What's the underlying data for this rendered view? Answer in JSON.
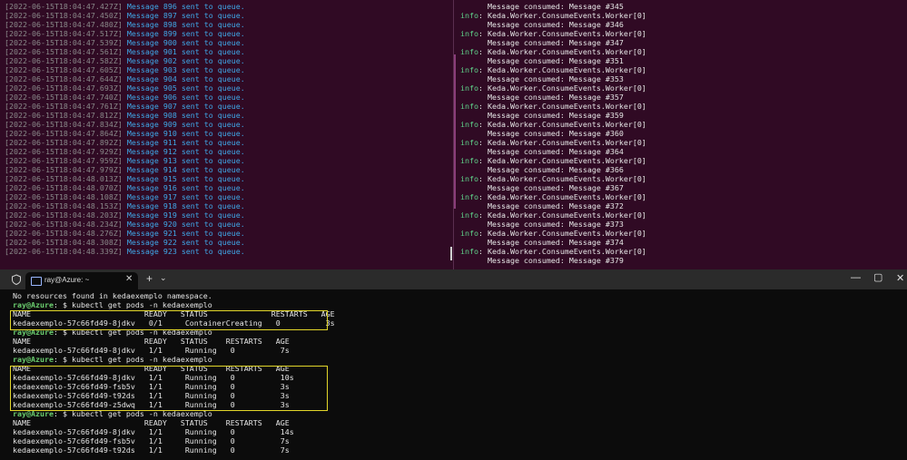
{
  "left_pane": {
    "lines": [
      {
        "ts": "[2022-06-15T18:04:47.427Z]",
        "msg": "Message 896 sent to queue."
      },
      {
        "ts": "[2022-06-15T18:04:47.450Z]",
        "msg": "Message 897 sent to queue."
      },
      {
        "ts": "[2022-06-15T18:04:47.480Z]",
        "msg": "Message 898 sent to queue."
      },
      {
        "ts": "[2022-06-15T18:04:47.517Z]",
        "msg": "Message 899 sent to queue."
      },
      {
        "ts": "[2022-06-15T18:04:47.539Z]",
        "msg": "Message 900 sent to queue."
      },
      {
        "ts": "[2022-06-15T18:04:47.561Z]",
        "msg": "Message 901 sent to queue."
      },
      {
        "ts": "[2022-06-15T18:04:47.582Z]",
        "msg": "Message 902 sent to queue."
      },
      {
        "ts": "[2022-06-15T18:04:47.605Z]",
        "msg": "Message 903 sent to queue."
      },
      {
        "ts": "[2022-06-15T18:04:47.644Z]",
        "msg": "Message 904 sent to queue."
      },
      {
        "ts": "[2022-06-15T18:04:47.693Z]",
        "msg": "Message 905 sent to queue."
      },
      {
        "ts": "[2022-06-15T18:04:47.740Z]",
        "msg": "Message 906 sent to queue."
      },
      {
        "ts": "[2022-06-15T18:04:47.761Z]",
        "msg": "Message 907 sent to queue."
      },
      {
        "ts": "[2022-06-15T18:04:47.812Z]",
        "msg": "Message 908 sent to queue."
      },
      {
        "ts": "[2022-06-15T18:04:47.834Z]",
        "msg": "Message 909 sent to queue."
      },
      {
        "ts": "[2022-06-15T18:04:47.864Z]",
        "msg": "Message 910 sent to queue."
      },
      {
        "ts": "[2022-06-15T18:04:47.892Z]",
        "msg": "Message 911 sent to queue."
      },
      {
        "ts": "[2022-06-15T18:04:47.929Z]",
        "msg": "Message 912 sent to queue."
      },
      {
        "ts": "[2022-06-15T18:04:47.959Z]",
        "msg": "Message 913 sent to queue."
      },
      {
        "ts": "[2022-06-15T18:04:47.979Z]",
        "msg": "Message 914 sent to queue."
      },
      {
        "ts": "[2022-06-15T18:04:48.013Z]",
        "msg": "Message 915 sent to queue."
      },
      {
        "ts": "[2022-06-15T18:04:48.070Z]",
        "msg": "Message 916 sent to queue."
      },
      {
        "ts": "[2022-06-15T18:04:48.108Z]",
        "msg": "Message 917 sent to queue."
      },
      {
        "ts": "[2022-06-15T18:04:48.153Z]",
        "msg": "Message 918 sent to queue."
      },
      {
        "ts": "[2022-06-15T18:04:48.203Z]",
        "msg": "Message 919 sent to queue."
      },
      {
        "ts": "[2022-06-15T18:04:48.234Z]",
        "msg": "Message 920 sent to queue."
      },
      {
        "ts": "[2022-06-15T18:04:48.276Z]",
        "msg": "Message 921 sent to queue."
      },
      {
        "ts": "[2022-06-15T18:04:48.308Z]",
        "msg": "Message 922 sent to queue."
      },
      {
        "ts": "[2022-06-15T18:04:48.339Z]",
        "msg": "Message 923 sent to queue."
      }
    ]
  },
  "right_pane": {
    "lines": [
      {
        "prefix": "",
        "text": "      Message consumed: Message #345"
      },
      {
        "prefix": "info",
        "text": ": Keda.Worker.ConsumeEvents.Worker[0]"
      },
      {
        "prefix": "",
        "text": "      Message consumed: Message #346"
      },
      {
        "prefix": "info",
        "text": ": Keda.Worker.ConsumeEvents.Worker[0]"
      },
      {
        "prefix": "",
        "text": "      Message consumed: Message #347"
      },
      {
        "prefix": "info",
        "text": ": Keda.Worker.ConsumeEvents.Worker[0]"
      },
      {
        "prefix": "",
        "text": "      Message consumed: Message #351"
      },
      {
        "prefix": "info",
        "text": ": Keda.Worker.ConsumeEvents.Worker[0]"
      },
      {
        "prefix": "",
        "text": "      Message consumed: Message #353"
      },
      {
        "prefix": "info",
        "text": ": Keda.Worker.ConsumeEvents.Worker[0]"
      },
      {
        "prefix": "",
        "text": "      Message consumed: Message #357"
      },
      {
        "prefix": "info",
        "text": ": Keda.Worker.ConsumeEvents.Worker[0]"
      },
      {
        "prefix": "",
        "text": "      Message consumed: Message #359"
      },
      {
        "prefix": "info",
        "text": ": Keda.Worker.ConsumeEvents.Worker[0]"
      },
      {
        "prefix": "",
        "text": "      Message consumed: Message #360"
      },
      {
        "prefix": "info",
        "text": ": Keda.Worker.ConsumeEvents.Worker[0]"
      },
      {
        "prefix": "",
        "text": "      Message consumed: Message #364"
      },
      {
        "prefix": "info",
        "text": ": Keda.Worker.ConsumeEvents.Worker[0]"
      },
      {
        "prefix": "",
        "text": "      Message consumed: Message #366"
      },
      {
        "prefix": "info",
        "text": ": Keda.Worker.ConsumeEvents.Worker[0]"
      },
      {
        "prefix": "",
        "text": "      Message consumed: Message #367"
      },
      {
        "prefix": "info",
        "text": ": Keda.Worker.ConsumeEvents.Worker[0]"
      },
      {
        "prefix": "",
        "text": "      Message consumed: Message #372"
      },
      {
        "prefix": "info",
        "text": ": Keda.Worker.ConsumeEvents.Worker[0]"
      },
      {
        "prefix": "",
        "text": "      Message consumed: Message #373"
      },
      {
        "prefix": "info",
        "text": ": Keda.Worker.ConsumeEvents.Worker[0]"
      },
      {
        "prefix": "",
        "text": "      Message consumed: Message #374"
      },
      {
        "prefix": "info",
        "text": ": Keda.Worker.ConsumeEvents.Worker[0]"
      },
      {
        "prefix": "",
        "text": "      Message consumed: Message #379"
      }
    ]
  },
  "window": {
    "tab_title": "ray@Azure: ~",
    "tab_close": "✕",
    "new_tab": "+",
    "tab_menu": "⌄",
    "minimize": "—",
    "maximize": "▢",
    "close": "✕"
  },
  "terminal": {
    "lines": [
      {
        "kind": "text",
        "text": "No resources found in kedaexemplo namespace."
      },
      {
        "kind": "prompt",
        "user": "ray@Azure",
        "sep": ": $ ",
        "cmd": "kubectl get pods -n kedaexemplo"
      },
      {
        "kind": "text",
        "text": "NAME                         READY   STATUS              RESTARTS   AGE"
      },
      {
        "kind": "text",
        "text": "kedaexemplo-57c66fd49-8jdkv   0/1     ContainerCreating   0          3s"
      },
      {
        "kind": "prompt",
        "user": "ray@Azure",
        "sep": ": $ ",
        "cmd": "kubectl get pods -n kedaexemplo"
      },
      {
        "kind": "text",
        "text": "NAME                         READY   STATUS    RESTARTS   AGE"
      },
      {
        "kind": "text",
        "text": "kedaexemplo-57c66fd49-8jdkv   1/1     Running   0          7s"
      },
      {
        "kind": "prompt",
        "user": "ray@Azure",
        "sep": ": $ ",
        "cmd": "kubectl get pods -n kedaexemplo"
      },
      {
        "kind": "text",
        "text": "NAME                         READY   STATUS    RESTARTS   AGE"
      },
      {
        "kind": "text",
        "text": "kedaexemplo-57c66fd49-8jdkv   1/1     Running   0          10s"
      },
      {
        "kind": "text",
        "text": "kedaexemplo-57c66fd49-fsb5v   1/1     Running   0          3s"
      },
      {
        "kind": "text",
        "text": "kedaexemplo-57c66fd49-t92ds   1/1     Running   0          3s"
      },
      {
        "kind": "text",
        "text": "kedaexemplo-57c66fd49-z5dwq   1/1     Running   0          3s"
      },
      {
        "kind": "prompt",
        "user": "ray@Azure",
        "sep": ": $ ",
        "cmd": "kubectl get pods -n kedaexemplo"
      },
      {
        "kind": "text",
        "text": "NAME                         READY   STATUS    RESTARTS   AGE"
      },
      {
        "kind": "text",
        "text": "kedaexemplo-57c66fd49-8jdkv   1/1     Running   0          14s"
      },
      {
        "kind": "text",
        "text": "kedaexemplo-57c66fd49-fsb5v   1/1     Running   0          7s"
      },
      {
        "kind": "text",
        "text": "kedaexemplo-57c66fd49-t92ds   1/1     Running   0          7s"
      }
    ]
  },
  "colors": {
    "pane_bg": "#300a24",
    "timestamp": "#8a8a8a",
    "message": "#3fa8e8",
    "info": "#5fd38a",
    "prompt": "#6cd070",
    "highlight": "#e2d62a"
  }
}
